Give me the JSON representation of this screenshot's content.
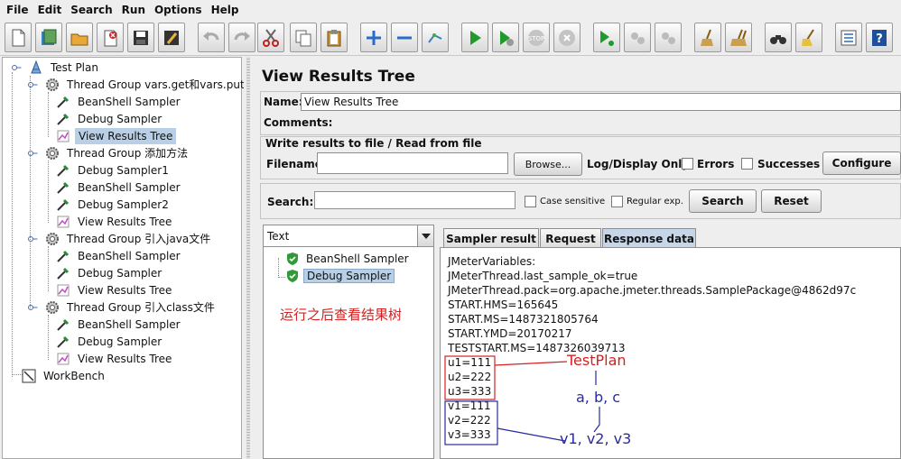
{
  "menu": [
    {
      "label": "File"
    },
    {
      "label": "Edit"
    },
    {
      "label": "Search"
    },
    {
      "label": "Run"
    },
    {
      "label": "Options"
    },
    {
      "label": "Help"
    }
  ],
  "tree": {
    "test_plan": "Test Plan",
    "groups": [
      {
        "label": "Thread Group  vars.get和vars.put",
        "children": [
          "BeanShell Sampler",
          "Debug Sampler",
          "View Results Tree"
        ]
      },
      {
        "label": "Thread Group  添加方法",
        "children": [
          "Debug Sampler1",
          "BeanShell Sampler",
          "Debug Sampler2",
          "View Results Tree"
        ]
      },
      {
        "label": "Thread Group 引入java文件",
        "children": [
          "BeanShell Sampler",
          "Debug Sampler",
          "View Results Tree"
        ]
      },
      {
        "label": "Thread Group 引入class文件",
        "children": [
          "BeanShell Sampler",
          "Debug Sampler",
          "View Results Tree"
        ]
      }
    ],
    "workbench": "WorkBench"
  },
  "panel": {
    "title": "View Results Tree",
    "name_label": "Name:",
    "name_value": "View Results Tree",
    "comments_label": "Comments:",
    "file_legend": "Write results to file / Read from file",
    "filename_label": "Filename",
    "filename_value": "",
    "browse_label": "Browse...",
    "log_display_label": "Log/Display Only:",
    "errors_label": "Errors",
    "successes_label": "Successes",
    "configure_label": "Configure",
    "search_label": "Search:",
    "search_value": "",
    "case_sensitive_label": "Case sensitive",
    "regular_exp_label": "Regular exp.",
    "search_button": "Search",
    "reset_button": "Reset"
  },
  "results": {
    "renderer": "Text",
    "samples": [
      "BeanShell Sampler",
      "Debug Sampler"
    ]
  },
  "tabs": [
    "Sampler result",
    "Request",
    "Response data"
  ],
  "response_lines": [
    "JMeterVariables:",
    "JMeterThread.last_sample_ok=true",
    "JMeterThread.pack=org.apache.jmeter.threads.SamplePackage@4862d97c",
    "START.HMS=165645",
    "START.MS=1487321805764",
    "START.YMD=20170217",
    "TESTSTART.MS=1487326039713",
    "u1=111",
    "u2=222",
    "u3=333",
    "v1=111",
    "v2=222",
    "v3=333"
  ],
  "annotations": {
    "run_note": "运行之后查看结果树",
    "testplan_note": "TestPlan",
    "abc_note": "a, b, c",
    "v_note": "v1, v2, v3"
  },
  "colors": {
    "annotation_red": "#d42020",
    "annotation_blue": "#2a2aa0",
    "selection": "#b8cfe5"
  }
}
